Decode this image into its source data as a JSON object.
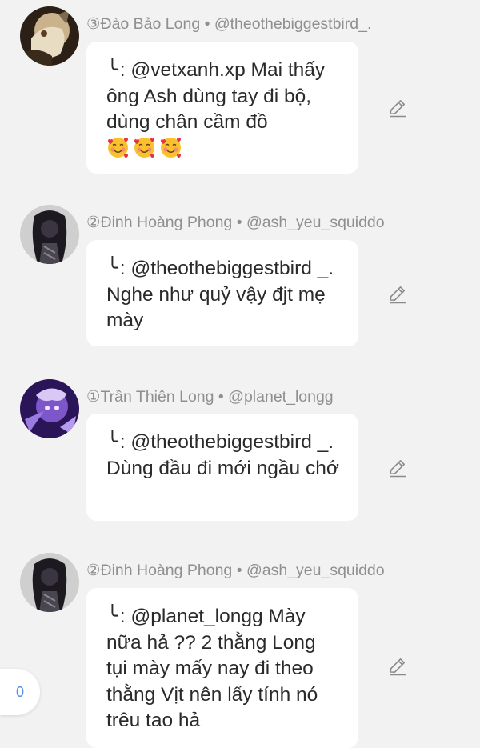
{
  "comments": [
    {
      "author": "③Đào Bảo Long",
      "separator": " • ",
      "handle": "@theothebiggestbird_.",
      "reply_marker": "╰",
      "text": ": @vetxanh.xp Mai thấy ông Ash dùng tay đi bộ, dùng chân cầm đồ",
      "emojis": [
        "smiling-face-with-hearts",
        "smiling-face-with-hearts",
        "smiling-face-with-hearts"
      ],
      "avatar": "avatar-light-character-icon"
    },
    {
      "author": "②Đinh Hoàng Phong",
      "separator": " • ",
      "handle": "@ash_yeu_squiddo",
      "reply_marker": "╰",
      "text": ": @theothebiggestbird _. Nghe như quỷ vậy đjt mẹ mày",
      "avatar": "avatar-dark-character-icon"
    },
    {
      "author": "①Trần Thiên Long",
      "separator": " • ",
      "handle": "@planet_longg",
      "reply_marker": "╰",
      "text": ": @theothebiggestbird _. Dùng đầu đi mới ngầu chớ",
      "avatar": "avatar-purple-character-icon"
    },
    {
      "author": "②Đinh Hoàng Phong",
      "separator": " • ",
      "handle": "@ash_yeu_squiddo",
      "reply_marker": "╰",
      "text": ": @planet_longg Mày nữa hả ?? 2 thằng Long tụi mày mấy nay đi theo thằng Vịt nên lấy tính nó trêu tao hả",
      "avatar": "avatar-dark-character-icon"
    }
  ],
  "edit_icon": "pencil-icon",
  "counter_value": "0",
  "colors": {
    "background": "#f2f2f2",
    "bubble": "#ffffff",
    "meta_text": "#8f8f8f",
    "body_text": "#2a2a2a",
    "counter_text": "#4d8ee6"
  }
}
